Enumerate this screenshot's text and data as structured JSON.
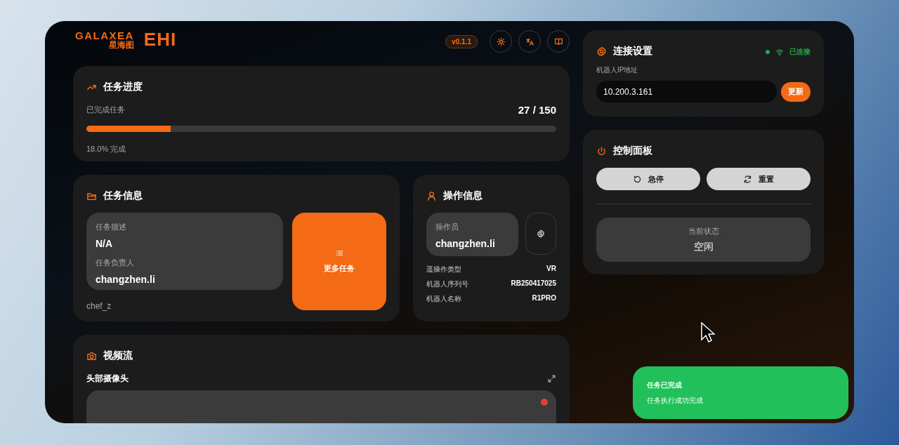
{
  "logo": {
    "wordmark": "GALAXEA",
    "subtitle": "星海图",
    "product": "EHI"
  },
  "header": {
    "version": "v0.1.1"
  },
  "progress": {
    "title": "任务进度",
    "label": "已完成任务",
    "count": "27 / 150",
    "level": 0.18,
    "percent_text": "18.0% 完成"
  },
  "task_info": {
    "title": "任务信息",
    "fields": [
      {
        "label": "任务描述",
        "value": "N/A"
      },
      {
        "label": "任务负责人",
        "value": "changzhen.li"
      }
    ],
    "footer": "chef_z",
    "more_button": "更多任务"
  },
  "operator_info": {
    "title": "操作信息",
    "operator_label": "操作员",
    "operator": "changzhen.li",
    "details": [
      {
        "label": "遥操作类型",
        "value": "VR"
      },
      {
        "label": "机器人序列号",
        "value": "RB250417025"
      },
      {
        "label": "机器人名称",
        "value": "R1PRO"
      }
    ]
  },
  "video": {
    "title": "视频流",
    "camera": "头部摄像头",
    "recording": true
  },
  "connection": {
    "title": "连接设置",
    "connected": true,
    "status": "已连接",
    "ip_label": "机器人IP地址",
    "ip_value": "10.200.3.161",
    "update_button": "更新"
  },
  "control": {
    "title": "控制面板",
    "buttons": [
      {
        "kind": "stop",
        "label": "急停"
      },
      {
        "kind": "reset",
        "label": "重置"
      }
    ],
    "state_label": "当前状态",
    "state": "空闲"
  },
  "toast": {
    "title": "任务已完成",
    "message": "任务执行成功完成"
  }
}
